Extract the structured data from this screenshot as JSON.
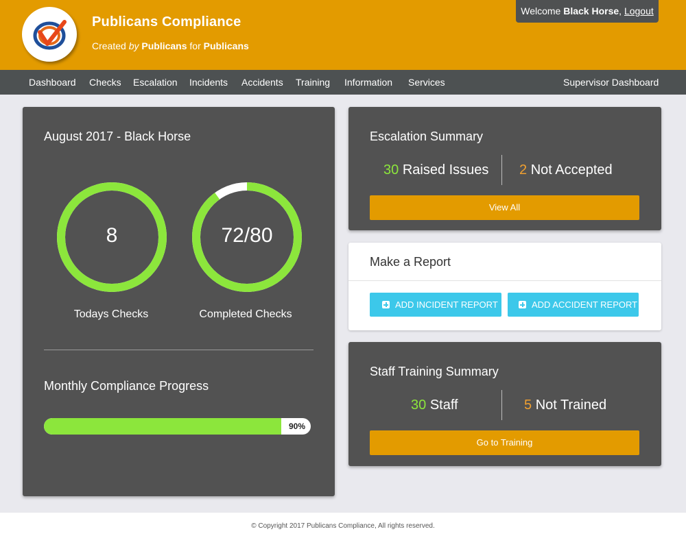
{
  "header": {
    "title": "Publicans Compliance",
    "subtitle": {
      "created": "Created",
      "by": "by",
      "brand1": "Publicans",
      "for": "for",
      "brand2": "Publicans"
    },
    "welcome": {
      "prefix": "Welcome",
      "user": "Black Horse",
      "logout": "Logout"
    },
    "logo_icon": "check-logo-icon",
    "brand_color": "#e39b00"
  },
  "nav": {
    "items": [
      {
        "label": "Dashboard"
      },
      {
        "label": "Checks"
      },
      {
        "label": "Escalation"
      },
      {
        "label": "Incidents"
      },
      {
        "label": "Accidents"
      },
      {
        "label": "Training"
      },
      {
        "label": "Information"
      },
      {
        "label": "Services"
      }
    ],
    "right_label": "Supervisor Dashboard"
  },
  "summary": {
    "title": "August 2017 - Black Horse",
    "todays_checks": {
      "value": "8",
      "label": "Todays Checks",
      "fraction": 1.0
    },
    "completed_checks": {
      "value": "72/80",
      "label": "Completed Checks",
      "fraction": 0.9
    },
    "progress_title": "Monthly Compliance Progress",
    "progress": {
      "percent": 90,
      "text": "90%"
    },
    "ring_color": "#8ce63c"
  },
  "escalation": {
    "title": "Escalation Summary",
    "raised_count": "30",
    "raised_label": "Raised Issues",
    "not_accepted_count": "2",
    "not_accepted_label": "Not Accepted",
    "button": "View All"
  },
  "report": {
    "title": "Make a Report",
    "incident_button": "ADD INCIDENT REPORT",
    "accident_button": "ADD ACCIDENT REPORT",
    "button_icon": "plus-square-icon"
  },
  "training": {
    "title": "Staff Training Summary",
    "staff_count": "30",
    "staff_label": "Staff",
    "not_trained_count": "5",
    "not_trained_label": "Not Trained",
    "button": "Go to Training"
  },
  "footer": {
    "text": "© Copyright 2017 Publicans Compliance, All rights reserved."
  }
}
